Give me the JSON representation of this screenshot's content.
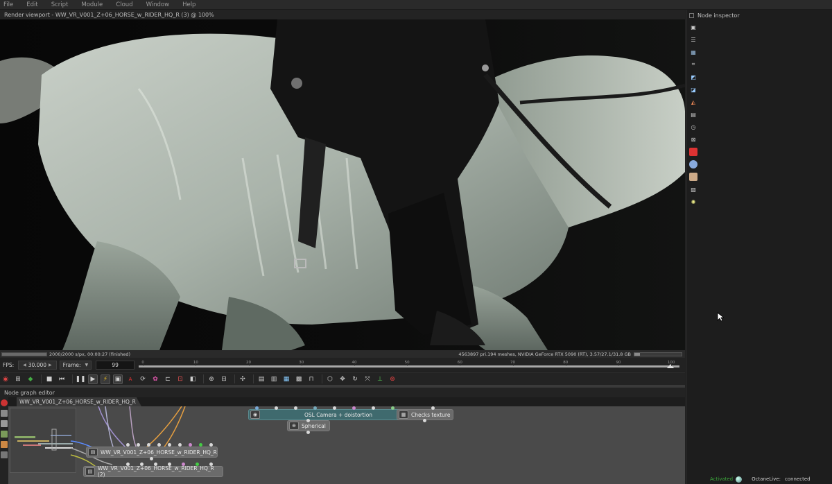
{
  "menubar": {
    "items": [
      "File",
      "Edit",
      "Script",
      "Module",
      "Cloud",
      "Window",
      "Help"
    ]
  },
  "viewport": {
    "title": "Render viewport - WW_VR_V001_Z+06_HORSE_w_RIDER_HQ_R (3) @ 100%",
    "status_left": "2000/2000 s/px, 00:00:27 (finished)",
    "status_right": "4563897 pri.194 meshes, NVIDIA GeForce RTX 5090 (RT), 3.57/27.1/31.8 GB",
    "render_progress": 1.0
  },
  "timeline": {
    "fps_label": "FPS:",
    "fps_value": "30.000",
    "frame_label": "Frame:",
    "frame_value": "99",
    "ruler_ticks": [
      "0",
      "10",
      "20",
      "30",
      "40",
      "50",
      "60",
      "70",
      "80",
      "90",
      "100"
    ],
    "current_frame": 99
  },
  "toolbar": {
    "icons": [
      "render-target-icon",
      "scene-icon",
      "color-cube-icon",
      "stop-icon",
      "rewind-icon",
      "pause-icon",
      "play-icon",
      "lightning-icon",
      "monitor-icon",
      "aov-icon",
      "sync-icon",
      "palette-icon",
      "region-icon",
      "focus-icon",
      "mask-icon",
      "zoom-icon",
      "crop-icon",
      "picker-icon",
      "save-icon",
      "load-icon",
      "image-icon",
      "texture-icon",
      "lock-icon",
      "cube-icon",
      "move-icon",
      "rotate-icon",
      "fullscreen-icon",
      "axis-icon",
      "gizmo-icon"
    ]
  },
  "node_graph": {
    "title": "Node graph editor",
    "tab": "WW_VR_V001_Z+06_HORSE_w_RIDER_HQ_R",
    "nodes": {
      "osl_camera": "OSL Camera + doistortion",
      "checks_texture": "Checks texture",
      "spherical": "Spherical",
      "scene_a": "WW_VR_V001_Z+06_HORSE_w_RIDER_HQ_R",
      "scene_b": "WW_VR_V001_Z+06_HORSE_w_RIDER_HQ_R (2)"
    }
  },
  "inspector": {
    "title": "Node inspector",
    "icons": [
      "layers-icon",
      "stack-icon",
      "image-icon",
      "camera-icon",
      "render-icon",
      "kernel-icon",
      "material-icon",
      "table-icon",
      "clock-icon",
      "transform-icon",
      "red-cube-icon",
      "blue-sphere-icon",
      "box-icon",
      "picture-icon",
      "sun-icon"
    ]
  },
  "footer": {
    "activated": "Activated",
    "octane_live_label": "OctaneLive:",
    "octane_live_status": "connected"
  },
  "colors": {
    "accent_teal": "#3f6a6e",
    "activated_green": "#3ba63b",
    "background": "#1e1e1e"
  }
}
